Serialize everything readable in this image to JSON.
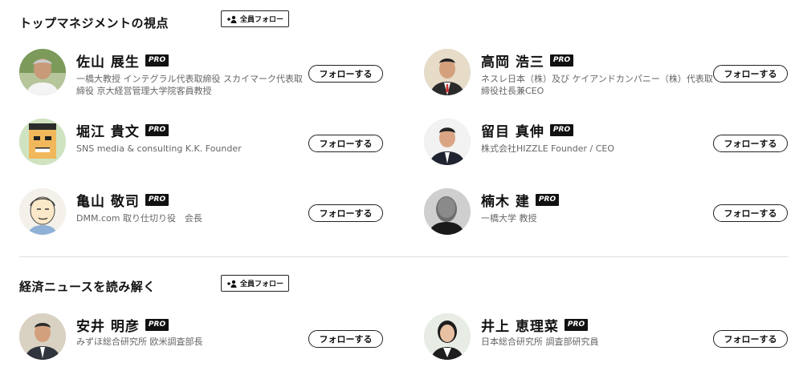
{
  "sections": [
    {
      "title": "トップマネジメントの視点",
      "follow_all_label": "全員フォロー",
      "people": [
        {
          "name": "佐山 展生",
          "pro": "PRO",
          "desc": "一橋大教授 インテグラル代表取締役 スカイマーク代表取締役 京大経営管理大学院客員教授",
          "follow": "フォローする",
          "avatar_icon": "avatar-photo"
        },
        {
          "name": "高岡 浩三",
          "pro": "PRO",
          "desc": "ネスレ日本（株）及び ケイアンドカンパニー（株）代表取締役社長兼CEO",
          "follow": "フォローする",
          "avatar_icon": "avatar-photo"
        },
        {
          "name": "堀江 貴文",
          "pro": "PRO",
          "desc": "SNS media & consulting K.K. Founder",
          "follow": "フォローする",
          "avatar_icon": "avatar-pixel-art"
        },
        {
          "name": "留目 真伸",
          "pro": "PRO",
          "desc": "株式会社HIZZLE Founder / CEO",
          "follow": "フォローする",
          "avatar_icon": "avatar-photo"
        },
        {
          "name": "亀山 敬司",
          "pro": "PRO",
          "desc": "DMM.com 取り仕切り役　会長",
          "follow": "フォローする",
          "avatar_icon": "avatar-illustration"
        },
        {
          "name": "楠木 建",
          "pro": "PRO",
          "desc": "一橋大学 教授",
          "follow": "フォローする",
          "avatar_icon": "avatar-photo"
        }
      ]
    },
    {
      "title": "経済ニュースを読み解く",
      "follow_all_label": "全員フォロー",
      "people": [
        {
          "name": "安井 明彦",
          "pro": "PRO",
          "desc": "みずほ総合研究所 欧米調査部長",
          "follow": "フォローする",
          "avatar_icon": "avatar-photo"
        },
        {
          "name": "井上 恵理菜",
          "pro": "PRO",
          "desc": "日本総合研究所 調査部研究員",
          "follow": "フォローする",
          "avatar_icon": "avatar-photo"
        }
      ]
    }
  ]
}
